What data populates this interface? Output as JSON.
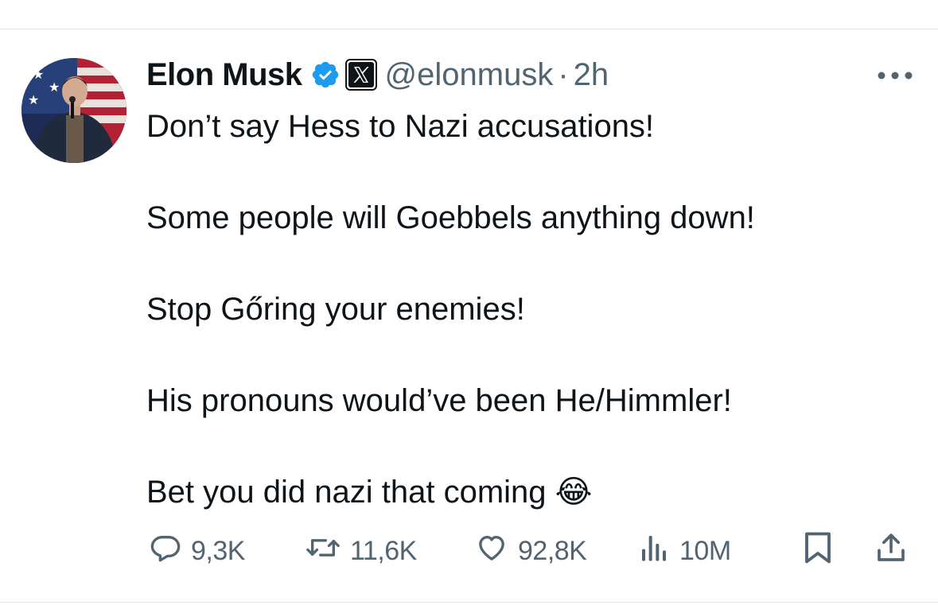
{
  "tweet": {
    "author_name": "Elon Musk",
    "handle": "@elonmusk",
    "separator": "·",
    "time": "2h",
    "body_lines": [
      "Don’t say Hess to Nazi accusations!",
      "",
      "Some people will Goebbels anything down!",
      "",
      "Stop Gőring your enemies!",
      "",
      "His pronouns would’ve been He/Himmler!",
      "",
      "Bet you did nazi that coming 😂"
    ]
  },
  "actions": {
    "replies": "9,3K",
    "reposts": "11,6K",
    "likes": "92,8K",
    "views": "10M"
  },
  "icons": {
    "verified": "verified-badge-icon",
    "affiliate": "x-logo-icon",
    "more": "more-dots-icon",
    "reply": "reply-icon",
    "repost": "repost-icon",
    "like": "heart-icon",
    "views": "views-icon",
    "bookmark": "bookmark-icon",
    "share": "share-icon"
  },
  "colors": {
    "text": "#0f1419",
    "secondary": "#536471",
    "verified": "#1d9bf0",
    "border": "#e6e9ec"
  }
}
